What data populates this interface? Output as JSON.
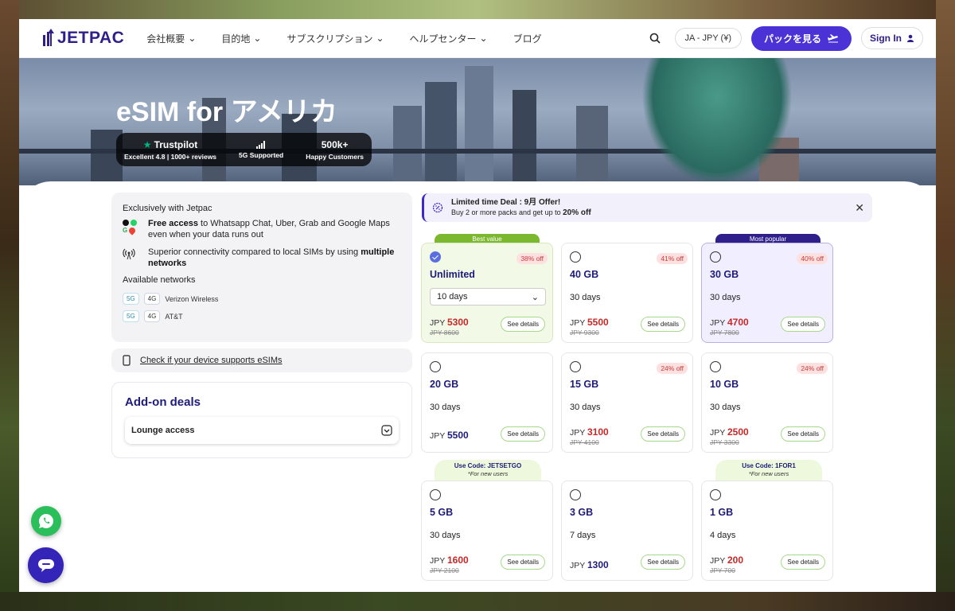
{
  "nav": {
    "logo_text": "JETPAC",
    "items": [
      "会社概要",
      "目的地",
      "サブスクリプション",
      "ヘルプセンター",
      "ブログ"
    ],
    "currency": "JA - JPY (¥)",
    "cta_label": "パックを見る",
    "signin_label": "Sign In"
  },
  "hero": {
    "title": "eSIM for アメリカ",
    "trust": {
      "trustpilot_label": "Trustpilot",
      "trustpilot_sub": "Excellent 4.8 | 1000+ reviews",
      "network_sub": "5G Supported",
      "customers_value": "500k+",
      "customers_sub": "Happy Customers"
    }
  },
  "info": {
    "exclusive_title": "Exclusively with Jetpac",
    "free_access_bold": "Free access",
    "free_access_text": " to Whatsapp Chat, Uber, Grab and Google Maps even when your data runs out",
    "connectivity_text": "Superior connectivity compared to local SIMs by using ",
    "connectivity_bold": "multiple networks",
    "networks_title": "Available networks",
    "networks": [
      {
        "g5": "5G",
        "g4": "4G",
        "name": "Verizon Wireless"
      },
      {
        "g5": "5G",
        "g4": "4G",
        "name": "AT&T"
      }
    ],
    "check_device": "Check if your device supports eSIMs"
  },
  "addon": {
    "title": "Add-on deals",
    "lounge": "Lounge access"
  },
  "deal": {
    "title": "Limited time Deal : 9月 Offer!",
    "text": "Buy 2 or more packs and get up to ",
    "bold": "20% off"
  },
  "tags": {
    "best_value": "Best value",
    "most_popular": "Most popular"
  },
  "codes": [
    {
      "code": "Use Code: JETSETGO",
      "note": "*For new users"
    },
    {
      "code": "Use Code: 1FOR1",
      "note": "*For new users"
    }
  ],
  "plans": [
    {
      "size": "Unlimited",
      "days": "10 days",
      "currency": "JPY",
      "price": "5300",
      "old": "JPY 8600",
      "off": "38% off",
      "btn": "See details"
    },
    {
      "size": "40 GB",
      "days": "30 days",
      "currency": "JPY",
      "price": "5500",
      "old": "JPY 9300",
      "off": "41% off",
      "btn": "See details"
    },
    {
      "size": "30 GB",
      "days": "30 days",
      "currency": "JPY",
      "price": "4700",
      "old": "JPY 7800",
      "off": "40% off",
      "btn": "See details"
    },
    {
      "size": "20 GB",
      "days": "30 days",
      "currency": "JPY",
      "price": "5500",
      "btn": "See details"
    },
    {
      "size": "15 GB",
      "days": "30 days",
      "currency": "JPY",
      "price": "3100",
      "old": "JPY 4100",
      "off": "24% off",
      "btn": "See details"
    },
    {
      "size": "10 GB",
      "days": "30 days",
      "currency": "JPY",
      "price": "2500",
      "old": "JPY 3300",
      "off": "24% off",
      "btn": "See details"
    },
    {
      "size": "5 GB",
      "days": "30 days",
      "currency": "JPY",
      "price": "1600",
      "old": "JPY 2100",
      "btn": "See details"
    },
    {
      "size": "3 GB",
      "days": "7 days",
      "currency": "JPY",
      "price": "1300",
      "btn": "See details"
    },
    {
      "size": "1 GB",
      "days": "4 days",
      "currency": "JPY",
      "price": "200",
      "old": "JPY 700",
      "btn": "See details"
    }
  ],
  "colors": {
    "brand": "#4b32d6",
    "navy": "#1e1b7a",
    "sale": "#c62828",
    "green": "#8bc34a",
    "whatsapp": "#2bbf5b"
  }
}
